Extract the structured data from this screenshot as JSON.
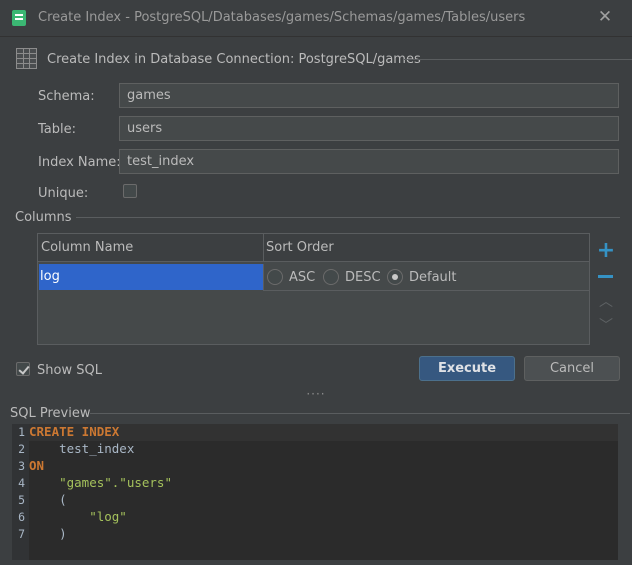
{
  "window": {
    "title": "Create Index - PostgreSQL/Databases/games/Schemas/games/Tables/users"
  },
  "header": {
    "text": "Create Index in Database Connection: PostgreSQL/games"
  },
  "form": {
    "schema_label": "Schema:",
    "schema_value": "games",
    "table_label": "Table:",
    "table_value": "users",
    "index_name_label": "Index Name:",
    "index_name_value": "test_index",
    "unique_label": "Unique:",
    "unique_checked": false
  },
  "columns": {
    "label": "Columns",
    "headers": [
      "Column Name",
      "Sort Order"
    ],
    "rows": [
      {
        "column_name": "log",
        "sort_order": "Default"
      }
    ],
    "sort_options": [
      "ASC",
      "DESC",
      "Default"
    ]
  },
  "actions": {
    "show_sql_label": "Show SQL",
    "show_sql_checked": true,
    "execute_label": "Execute",
    "cancel_label": "Cancel"
  },
  "sql_preview": {
    "label": "SQL Preview",
    "lines": [
      {
        "number": "1",
        "text": "CREATE INDEX"
      },
      {
        "number": "2",
        "text": "    test_index"
      },
      {
        "number": "3",
        "text": "ON"
      },
      {
        "number": "4",
        "text": "    \"games\".\"users\""
      },
      {
        "number": "5",
        "text": "    ("
      },
      {
        "number": "6",
        "text": "        \"log\""
      },
      {
        "number": "7",
        "text": "    )"
      }
    ]
  },
  "icons": {
    "app": "database-sql-icon",
    "close": "close-icon",
    "table": "table-grid-icon",
    "add": "plus-icon",
    "remove": "minus-icon",
    "up": "chevron-up-icon",
    "down": "chevron-down-icon"
  },
  "colors": {
    "background": "#3c3f41",
    "selection": "#2f65ca",
    "accent": "#3592c4",
    "execute_button": "#365880",
    "editor_bg": "#2b2b2b",
    "keyword": "#cc7832",
    "string": "#a5c25c"
  }
}
